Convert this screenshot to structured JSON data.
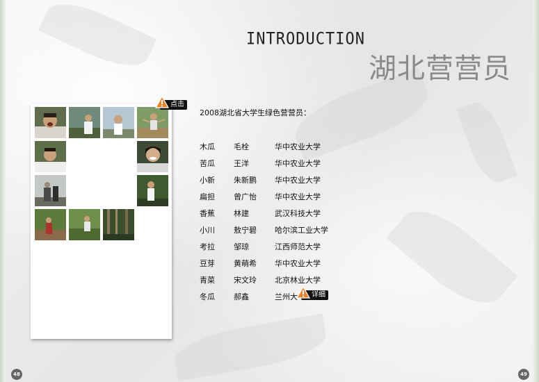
{
  "header": {
    "intro_title": "INTRODUCTION",
    "section_title": "湖北营营员"
  },
  "photo_panel": {
    "badge_label": "点击"
  },
  "roster": {
    "heading": "2008湖北省大学生绿色营营员：",
    "members": [
      {
        "nickname": "木瓜",
        "name": "毛栓",
        "school": "华中农业大学"
      },
      {
        "nickname": "苦瓜",
        "name": "王洋",
        "school": "华中农业大学"
      },
      {
        "nickname": "小新",
        "name": "朱新鹏",
        "school": "华中农业大学"
      },
      {
        "nickname": "扁担",
        "name": "曾广怡",
        "school": "华中农业大学"
      },
      {
        "nickname": "香蕉",
        "name": "林建",
        "school": "武汉科技大学"
      },
      {
        "nickname": "小川",
        "name": "敖宁碧",
        "school": "哈尔滨工业大学"
      },
      {
        "nickname": "考拉",
        "name": "邹琼",
        "school": "江西师范大学"
      },
      {
        "nickname": "豆芽",
        "name": "黄萌希",
        "school": "华中农业大学"
      },
      {
        "nickname": "青菜",
        "name": "宋文玲",
        "school": "北京林业大学"
      },
      {
        "nickname": "冬瓜",
        "name": "郝鑫",
        "school": "兰州大"
      }
    ],
    "detail_badge_label": "详细"
  },
  "pages": {
    "left": "48",
    "right": "49"
  },
  "colors": {
    "badge_bg": "#111111",
    "warn_orange": "#e8832a",
    "section_title": "#8a8a8a"
  }
}
